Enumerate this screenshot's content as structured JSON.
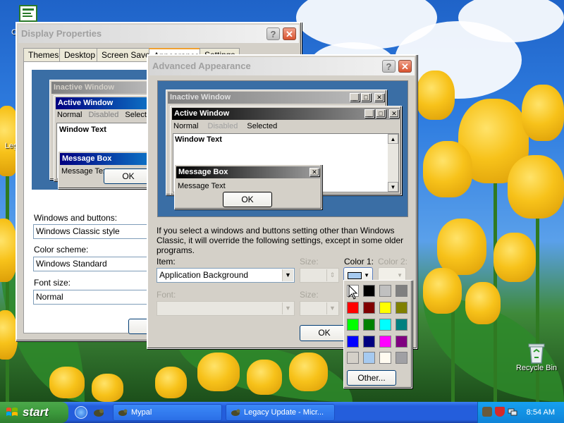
{
  "desktop": {
    "icons": [
      {
        "label": "C"
      },
      {
        "label": "Leg"
      },
      {
        "label": "Recycle Bin"
      }
    ]
  },
  "display_properties": {
    "title": "Display Properties",
    "tabs": [
      "Themes",
      "Desktop",
      "Screen Saver",
      "Appearance",
      "Settings"
    ],
    "preview": {
      "inactive_window": "Inactive Window",
      "active_window": "Active Window",
      "menu": [
        "Normal",
        "Disabled",
        "Selected"
      ],
      "window_text": "Window Text",
      "message_box": "Message Box",
      "message_text": "Message Text",
      "ok": "OK"
    },
    "windows_buttons_label": "Windows and buttons:",
    "windows_buttons_value": "Windows Classic style",
    "color_scheme_label": "Color scheme:",
    "color_scheme_value": "Windows Standard",
    "font_size_label": "Font size:",
    "font_size_value": "Normal"
  },
  "advanced_appearance": {
    "title": "Advanced Appearance",
    "preview": {
      "inactive_window": "Inactive Window",
      "active_window": "Active Window",
      "menu": [
        "Normal",
        "Disabled",
        "Selected"
      ],
      "window_text": "Window Text",
      "message_box": "Message Box",
      "message_text": "Message Text",
      "ok": "OK"
    },
    "info_text": "If you select a windows and buttons setting other than Windows Classic, it will override the following settings, except in some older programs.",
    "item_label": "Item:",
    "item_value": "Application Background",
    "size_label": "Size:",
    "color1_label": "Color 1:",
    "color2_label": "Color 2:",
    "font_label": "Font:",
    "font_size_label": "Size:",
    "ok_label": "OK"
  },
  "palette": {
    "colors": [
      "#ffffff",
      "#000000",
      "#c0c0c0",
      "#808080",
      "#ff0000",
      "#800000",
      "#ffff00",
      "#808000",
      "#00ff00",
      "#008000",
      "#00ffff",
      "#008080",
      "#0000ff",
      "#000080",
      "#ff00ff",
      "#800080",
      "#d4d0c8",
      "#a6caf0",
      "#fffbf0",
      "#a0a0a4"
    ],
    "other_label": "Other..."
  },
  "taskbar": {
    "start_label": "start",
    "tasks": [
      "Mypal",
      "Legacy Update - Micr..."
    ],
    "clock": "8:54 AM"
  }
}
